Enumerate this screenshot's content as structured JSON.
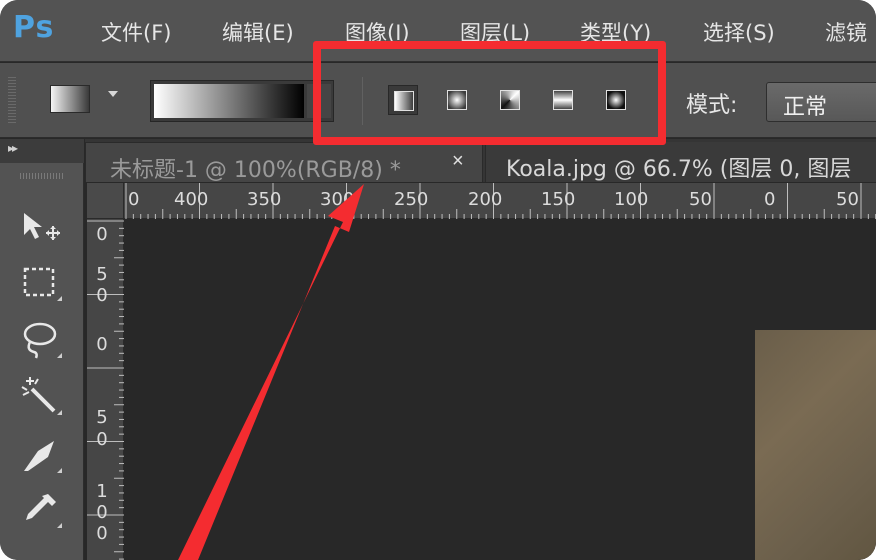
{
  "app": {
    "logo": "Ps"
  },
  "menubar": {
    "items": [
      "文件(F)",
      "编辑(E)",
      "图像(I)",
      "图层(L)",
      "类型(Y)",
      "选择(S)",
      "滤镜"
    ]
  },
  "options_bar": {
    "gradient_types": [
      "linear-gradient",
      "radial-gradient",
      "angle-gradient",
      "reflected-gradient",
      "diamond-gradient"
    ],
    "active_gradient_type": "linear-gradient",
    "mode_label": "模式:",
    "mode_value": "正常"
  },
  "tabs": [
    {
      "label": "未标题-1 @ 100%(RGB/8) *",
      "close": "×",
      "active": true
    },
    {
      "label": "Koala.jpg @ 66.7% (图层 0, 图层",
      "active": false
    }
  ],
  "ruler_top": {
    "labels": [
      "0",
      "400",
      "350",
      "300",
      "250",
      "200",
      "150",
      "100",
      "50",
      "0",
      "50"
    ]
  },
  "ruler_left": {
    "labels": [
      "0",
      "50",
      "0",
      "50",
      "100"
    ]
  },
  "tools": [
    "move-tool",
    "marquee-tool",
    "lasso-tool",
    "magic-wand-tool",
    "crop-tool",
    "eyedropper-tool"
  ],
  "annotation": {
    "highlight_color": "#f42c30",
    "arrow_color": "#f42c30"
  }
}
